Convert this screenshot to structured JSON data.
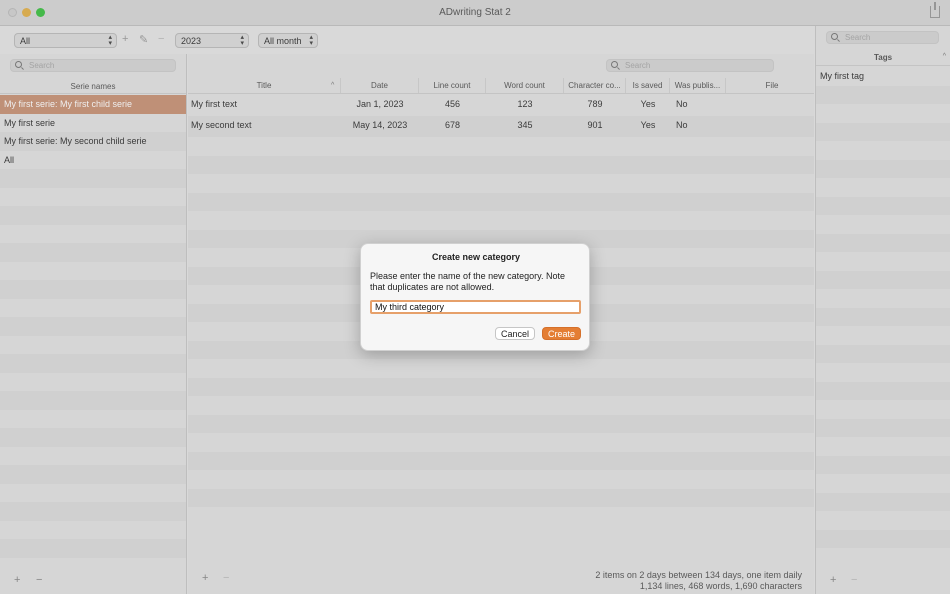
{
  "window": {
    "title": "ADwriting Stat 2"
  },
  "toolbar": {
    "category_filter": "All",
    "year_filter": "2023",
    "month_filter": "All month"
  },
  "sidebar": {
    "search_placeholder": "Search",
    "column_header": "Serie names",
    "items": [
      {
        "label": "My first serie: My first child serie",
        "selected": true
      },
      {
        "label": "My first serie",
        "selected": false
      },
      {
        "label": "My first serie: My second child serie",
        "selected": false
      },
      {
        "label": "All",
        "selected": false
      }
    ]
  },
  "table": {
    "search_placeholder": "Search",
    "columns": [
      "Title",
      "Date",
      "Line count",
      "Word count",
      "Character co...",
      "Is saved",
      "Was publis...",
      "File"
    ],
    "rows": [
      {
        "title": "My first text",
        "date": "Jan 1, 2023",
        "lines": "456",
        "words": "123",
        "chars": "789",
        "saved": "Yes",
        "published": "No",
        "file": ""
      },
      {
        "title": "My second text",
        "date": "May 14, 2023",
        "lines": "678",
        "words": "345",
        "chars": "901",
        "saved": "Yes",
        "published": "No",
        "file": ""
      }
    ],
    "status_line1": "2 items on 2 days between 134 days, one item daily",
    "status_line2": "1,134 lines, 468 words, 1,690 characters"
  },
  "tags": {
    "search_placeholder": "Search",
    "header": "Tags",
    "items": [
      "My first tag"
    ]
  },
  "dialog": {
    "title": "Create new category",
    "message": "Please enter the name of the new category. Note that duplicates are not allowed.",
    "input_value": "My third category",
    "cancel_label": "Cancel",
    "create_label": "Create",
    "accent_color": "#e47e34"
  }
}
